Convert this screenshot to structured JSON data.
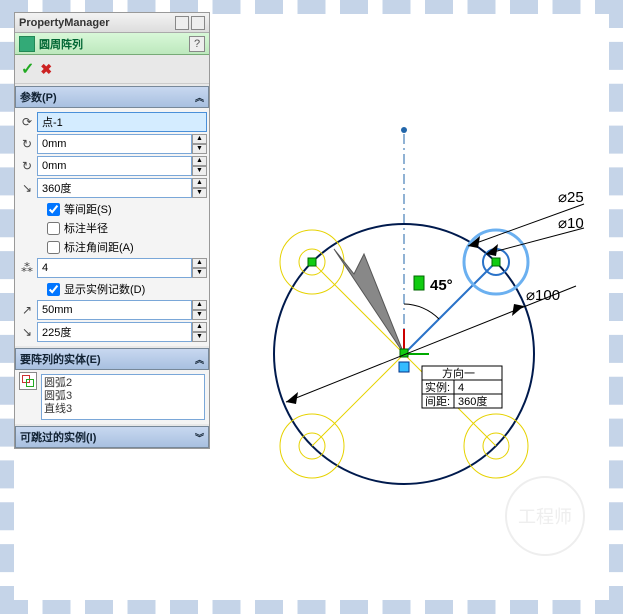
{
  "pm_title": "PropertyManager",
  "cmd_title": "圆周阵列",
  "sections": {
    "params": {
      "title": "参数(P)"
    },
    "entities": {
      "title": "要阵列的实体(E)"
    },
    "skip": {
      "title": "可跳过的实例(I)"
    }
  },
  "fields": {
    "center": "点-1",
    "spacingX": "0mm",
    "spacingY": "0mm",
    "angle": "360度",
    "count": "4",
    "radius": "50mm",
    "startAngle": "225度"
  },
  "checks": {
    "equal": "等间距(S)",
    "dimR": "标注半径",
    "dimA": "标注角间距(A)",
    "showCount": "显示实例记数(D)"
  },
  "entities": [
    "圆弧2",
    "圆弧3",
    "直线3"
  ],
  "viewport": {
    "angle": "45°",
    "d100": "⌀100",
    "d25": "⌀25",
    "d10": "⌀10",
    "table": {
      "r1": "方向一",
      "r2a": "实例:",
      "r2b": "4",
      "r3a": "间距:",
      "r3b": "360度"
    }
  },
  "watermark": "工程师"
}
